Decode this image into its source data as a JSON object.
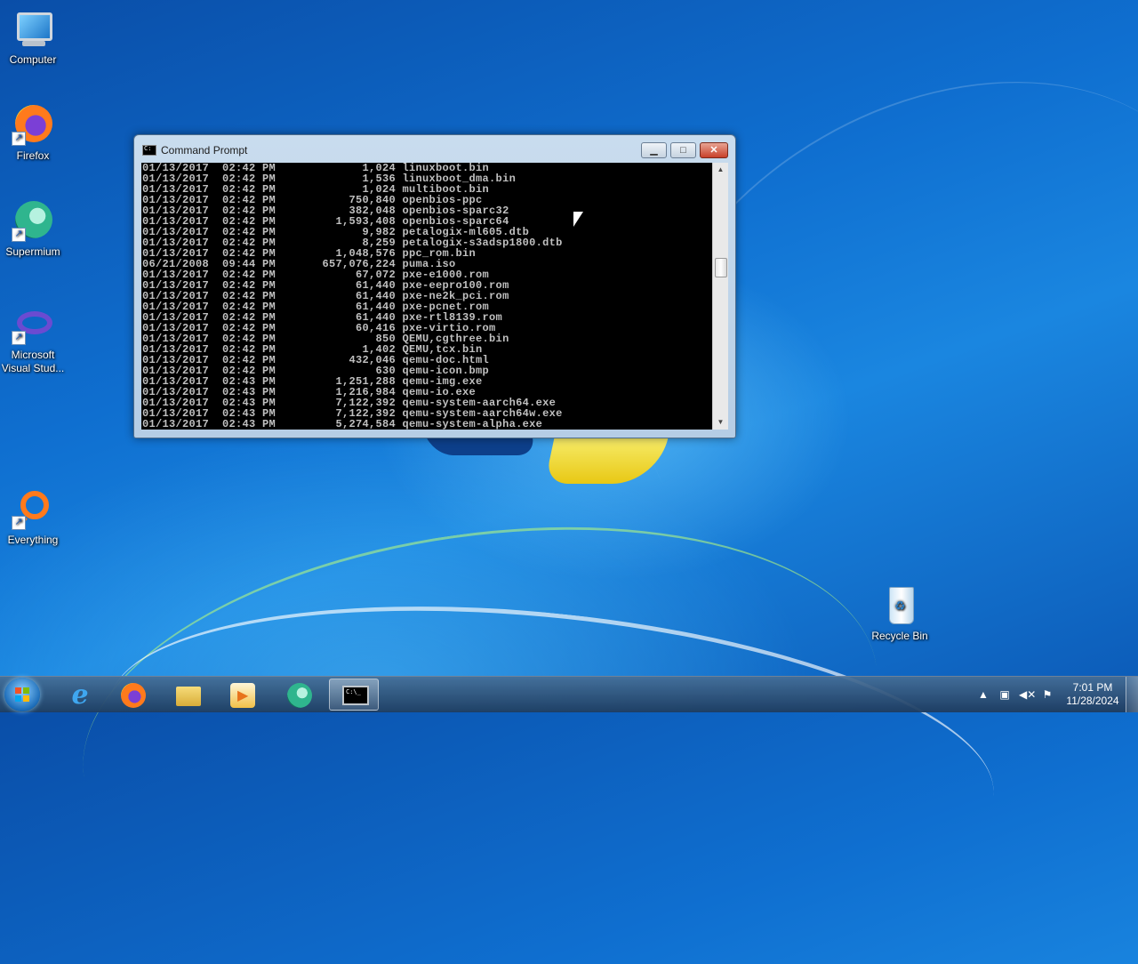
{
  "desktop": {
    "icons": [
      {
        "label": "Computer"
      },
      {
        "label": "Firefox"
      },
      {
        "label": "Supermium"
      },
      {
        "label": "Microsoft Visual Stud..."
      },
      {
        "label": "Everything"
      },
      {
        "label": "Recycle Bin"
      }
    ]
  },
  "window": {
    "title": "Command Prompt",
    "console_lines": [
      "01/13/2017  02:42 PM             1,024 linuxboot.bin",
      "01/13/2017  02:42 PM             1,536 linuxboot_dma.bin",
      "01/13/2017  02:42 PM             1,024 multiboot.bin",
      "01/13/2017  02:42 PM           750,840 openbios-ppc",
      "01/13/2017  02:42 PM           382,048 openbios-sparc32",
      "01/13/2017  02:42 PM         1,593,408 openbios-sparc64",
      "01/13/2017  02:42 PM             9,982 petalogix-ml605.dtb",
      "01/13/2017  02:42 PM             8,259 petalogix-s3adsp1800.dtb",
      "01/13/2017  02:42 PM         1,048,576 ppc_rom.bin",
      "06/21/2008  09:44 PM       657,076,224 puma.iso",
      "01/13/2017  02:42 PM            67,072 pxe-e1000.rom",
      "01/13/2017  02:42 PM            61,440 pxe-eepro100.rom",
      "01/13/2017  02:42 PM            61,440 pxe-ne2k_pci.rom",
      "01/13/2017  02:42 PM            61,440 pxe-pcnet.rom",
      "01/13/2017  02:42 PM            61,440 pxe-rtl8139.rom",
      "01/13/2017  02:42 PM            60,416 pxe-virtio.rom",
      "01/13/2017  02:42 PM               850 QEMU,cgthree.bin",
      "01/13/2017  02:42 PM             1,402 QEMU,tcx.bin",
      "01/13/2017  02:42 PM           432,046 qemu-doc.html",
      "01/13/2017  02:42 PM               630 qemu-icon.bmp",
      "01/13/2017  02:43 PM         1,251,288 qemu-img.exe",
      "01/13/2017  02:43 PM         1,216,984 qemu-io.exe",
      "01/13/2017  02:43 PM         7,122,392 qemu-system-aarch64.exe",
      "01/13/2017  02:43 PM         7,122,392 qemu-system-aarch64w.exe",
      "01/13/2017  02:43 PM         5,274,584 qemu-system-alpha.exe"
    ]
  },
  "taskbar": {
    "clock_time": "7:01 PM",
    "clock_date": "11/28/2024",
    "tray_icons": [
      "chevron-up-icon",
      "network-icon",
      "volume-muted-icon",
      "action-center-flag-icon"
    ]
  }
}
